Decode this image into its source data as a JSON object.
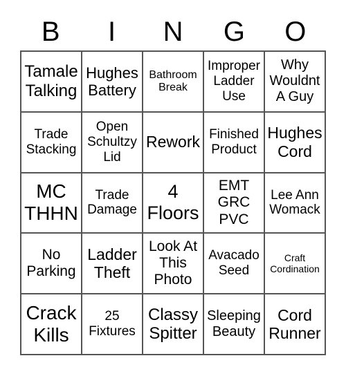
{
  "header": [
    "B",
    "I",
    "N",
    "G",
    "O"
  ],
  "cells": [
    {
      "text": "Tamale Talking",
      "size": 24
    },
    {
      "text": "Hughes Battery",
      "size": 22
    },
    {
      "text": "Bathroom Break",
      "size": 16
    },
    {
      "text": "Improper Ladder Use",
      "size": 19
    },
    {
      "text": "Why Wouldnt A Guy",
      "size": 20
    },
    {
      "text": "Trade Stacking",
      "size": 19
    },
    {
      "text": "Open Schultzy Lid",
      "size": 19
    },
    {
      "text": "Rework",
      "size": 23
    },
    {
      "text": "Finished Product",
      "size": 19
    },
    {
      "text": "Hughes Cord",
      "size": 23
    },
    {
      "text": "MC THHN",
      "size": 28
    },
    {
      "text": "Trade Damage",
      "size": 19
    },
    {
      "text": "4 Floors",
      "size": 27
    },
    {
      "text": "EMT GRC PVC",
      "size": 21
    },
    {
      "text": "Lee Ann Womack",
      "size": 19
    },
    {
      "text": "No Parking",
      "size": 21
    },
    {
      "text": "Ladder Theft",
      "size": 23
    },
    {
      "text": "Look At This Photo",
      "size": 21
    },
    {
      "text": "Avacado Seed",
      "size": 19
    },
    {
      "text": "Craft Cordination",
      "size": 14
    },
    {
      "text": "Crack Kills",
      "size": 28
    },
    {
      "text": "25 Fixtures",
      "size": 19
    },
    {
      "text": "Classy Spitter",
      "size": 24
    },
    {
      "text": "Sleeping Beauty",
      "size": 20
    },
    {
      "text": "Cord Runner",
      "size": 23
    }
  ]
}
